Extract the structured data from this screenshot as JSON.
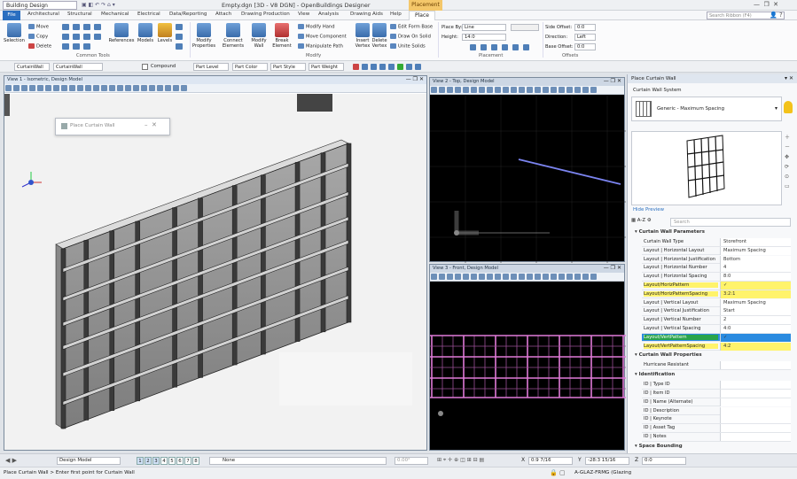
{
  "titlebar": {
    "workspace": "Building Design",
    "title": "Empty.dgn [3D - V8 DGN] - OpenBuildings Designer",
    "context_tab": "Placement"
  },
  "ribbon_tabs": [
    "File",
    "Architectural",
    "Structural",
    "Mechanical",
    "Electrical",
    "Data/Reporting",
    "Attach",
    "Drawing Production",
    "View",
    "Analysis",
    "Drawing Aids",
    "Help",
    "Place"
  ],
  "search_ribbon_placeholder": "Search Ribbon (F4)",
  "ribbon": {
    "selection": "Selection",
    "move": "Move",
    "copy": "Copy",
    "delete": "Delete",
    "references": "References",
    "models": "Models",
    "levels": "Levels",
    "common_tools": "Common Tools",
    "modify_properties": "Modify Properties",
    "connect_elements": "Connect Elements",
    "modify_wall": "Modify Wall",
    "break_element": "Break Element",
    "modify_hand": "Modify Hand",
    "move_component": "Move Component",
    "manipulate_path": "Manipulate Path",
    "insert_vertex": "Insert Vertex",
    "delete_vertex": "Delete Vertex",
    "edit_form_base": "Edit Form Base",
    "draw_on_solid": "Draw On Solid",
    "unite_solids": "Unite Solids",
    "modify_group": "Modify",
    "place_by_label": "Place By:",
    "place_by_value": "Line",
    "height_label": "Height:",
    "height_value": "14:0",
    "placement_group": "Placement",
    "side_offset_label": "Side Offset:",
    "side_offset_value": "0:0",
    "direction_label": "Direction:",
    "direction_value": "Left",
    "base_offset_label": "Base Offset:",
    "base_offset_value": "0:0",
    "offsets_group": "Offsets"
  },
  "attrbar": {
    "category": "CurtainWall",
    "style": "CurtainWall",
    "compound": "Compound",
    "part_level": "Part Level",
    "part_color": "Part Color",
    "part_style": "Part Style",
    "part_weight": "Part Weight"
  },
  "views": {
    "v1_title": "View 1 - Isometric, Design Model",
    "v2_title": "View 2 - Top, Design Model",
    "v3_title": "View 3 - Front, Design Model"
  },
  "float_dialog": {
    "title": "Place Curtain Wall"
  },
  "panel": {
    "title": "Place Curtain Wall",
    "system_label": "Curtain Wall System",
    "preset": "Generic - Maximum Spacing",
    "hide_preview": "Hide Preview",
    "search_placeholder": "Search",
    "sections": {
      "params": "Curtain Wall Parameters",
      "props": "Curtain Wall Properties",
      "ident": "Identification",
      "space": "Space Bounding"
    },
    "params": [
      {
        "k": "Curtain Wall Type",
        "v": "Storefront"
      },
      {
        "k": "Layout | Horizontal Layout",
        "v": "Maximum Spacing"
      },
      {
        "k": "Layout | Horizontal Justification",
        "v": "Bottom"
      },
      {
        "k": "Layout | Horizontal Number",
        "v": "4"
      },
      {
        "k": "Layout | Horizontal Spacing",
        "v": "8:0"
      },
      {
        "k": "Layout/HorizPattern",
        "v": "✓"
      },
      {
        "k": "Layout/HorizPatternSpacing",
        "v": "3:2:1"
      },
      {
        "k": "Layout | Vertical Layout",
        "v": "Maximum Spacing"
      },
      {
        "k": "Layout | Vertical Justification",
        "v": "Start"
      },
      {
        "k": "Layout | Vertical Number",
        "v": "2"
      },
      {
        "k": "Layout | Vertical Spacing",
        "v": "4:0"
      },
      {
        "k": "Layout/VertPattern",
        "v": "✓"
      },
      {
        "k": "Layout/VertPatternSpacing",
        "v": "4:2"
      }
    ],
    "props": [
      {
        "k": "Hurricane Resistant",
        "v": ""
      }
    ],
    "ident": [
      {
        "k": "ID | Type ID",
        "v": ""
      },
      {
        "k": "ID | Item ID",
        "v": ""
      },
      {
        "k": "ID | Name (Alternate)",
        "v": ""
      },
      {
        "k": "ID | Description",
        "v": ""
      },
      {
        "k": "ID | Keynote",
        "v": ""
      },
      {
        "k": "ID | Asset Tag",
        "v": ""
      },
      {
        "k": "ID | Notes",
        "v": ""
      }
    ]
  },
  "status": {
    "model": "Design Model",
    "views": [
      "1",
      "2",
      "3",
      "4",
      "5",
      "6",
      "7",
      "8"
    ],
    "level": "None",
    "angle": "0.00°",
    "x_label": "X",
    "x_value": "0:9 7/16",
    "y_label": "Y",
    "y_value": "-28:3 15/16",
    "z_label": "Z",
    "z_value": "0:0",
    "prompt": "Place Curtain Wall > Enter first point for Curtain Wall",
    "active_level": "A-GLAZ-FRMG (Glazing"
  },
  "colors": {
    "accent": "#2a6fc0",
    "highlight": "#fff36b",
    "selected": "#2a8be0"
  }
}
